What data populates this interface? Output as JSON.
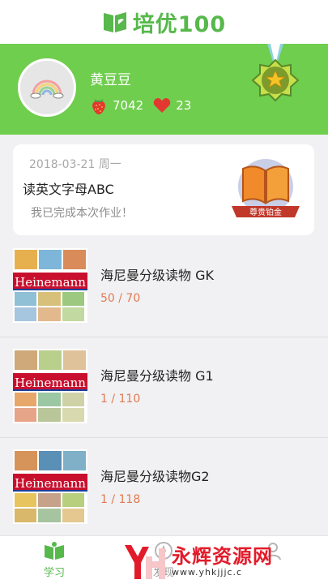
{
  "app": {
    "name": "培优100"
  },
  "profile": {
    "username": "黄豆豆",
    "points": "7042",
    "likes": "23"
  },
  "homework": {
    "date": "2018-03-21 周一",
    "title": "读英文字母ABC",
    "status": "我已完成本次作业！",
    "badge_label": "尊贵铂金"
  },
  "books": [
    {
      "title": "海尼曼分级读物 GK",
      "progress": "50 / 70",
      "cover_label": "Heinemann"
    },
    {
      "title": "海尼曼分级读物 G1",
      "progress": "1 / 110",
      "cover_label": "Heinemann"
    },
    {
      "title": "海尼曼分级读物G2",
      "progress": "1 / 118",
      "cover_label": "Heinemann"
    }
  ],
  "nav": {
    "learn": "学习",
    "discover": "发现"
  },
  "watermark": {
    "text": "永辉资源网",
    "url": "www.yhkjjjc.c"
  },
  "colors": {
    "brand_green": "#57b84b",
    "banner_green": "#6fce4d",
    "progress_orange": "#e17a52"
  }
}
